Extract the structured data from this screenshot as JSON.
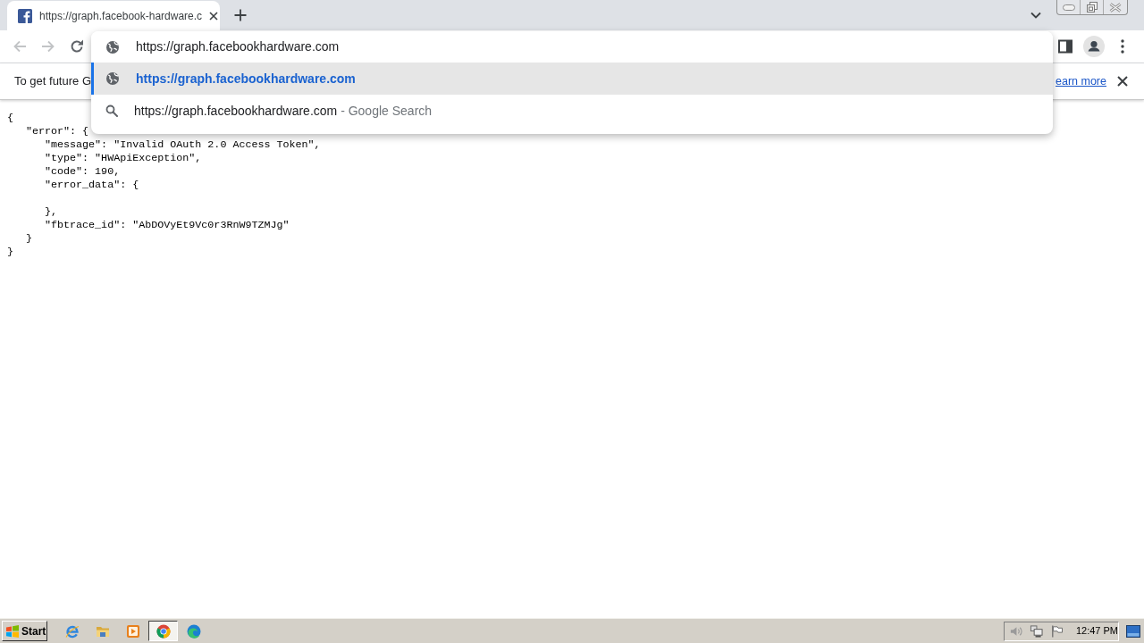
{
  "browser": {
    "tabs": [
      {
        "title": "https://graph.facebook-hardware.c",
        "selected": true
      }
    ],
    "toolbar": {
      "back": {
        "disabled": true
      },
      "forward": {
        "disabled": true
      }
    },
    "omnibox": {
      "value": "https://graph.facebookhardware.com"
    },
    "suggestions": [
      {
        "kind": "url",
        "text": "https://graph.facebookhardware.com",
        "selected": true
      },
      {
        "kind": "search",
        "text": "https://graph.facebookhardware.com",
        "suffix": "- Google Search",
        "selected": false
      }
    ],
    "infobar": {
      "message": "To get future G",
      "link": "earn more"
    }
  },
  "document": {
    "open": "{",
    "children": [
      {
        "open": "\"error\": {",
        "children": [
          {
            "line": "\"message\": \"Invalid OAuth 2.0 Access Token\","
          },
          {
            "line": "\"type\": \"HWApiException\","
          },
          {
            "line": "\"code\": 190,"
          },
          {
            "open": "\"error_data\": {",
            "close": "},"
          },
          {
            "line": "\"fbtrace_id\": \"AbDOVyEt9Vc0r3RnW9TZMJg\""
          }
        ],
        "close": "}"
      }
    ],
    "close": "}"
  },
  "taskbar": {
    "start": "Start",
    "apps": [
      {
        "kind": "ie",
        "active": false
      },
      {
        "kind": "folder",
        "active": false
      },
      {
        "kind": "media",
        "active": false
      },
      {
        "kind": "chrome",
        "active": true
      },
      {
        "kind": "edge",
        "active": false
      }
    ],
    "clock": "12:47 PM"
  }
}
